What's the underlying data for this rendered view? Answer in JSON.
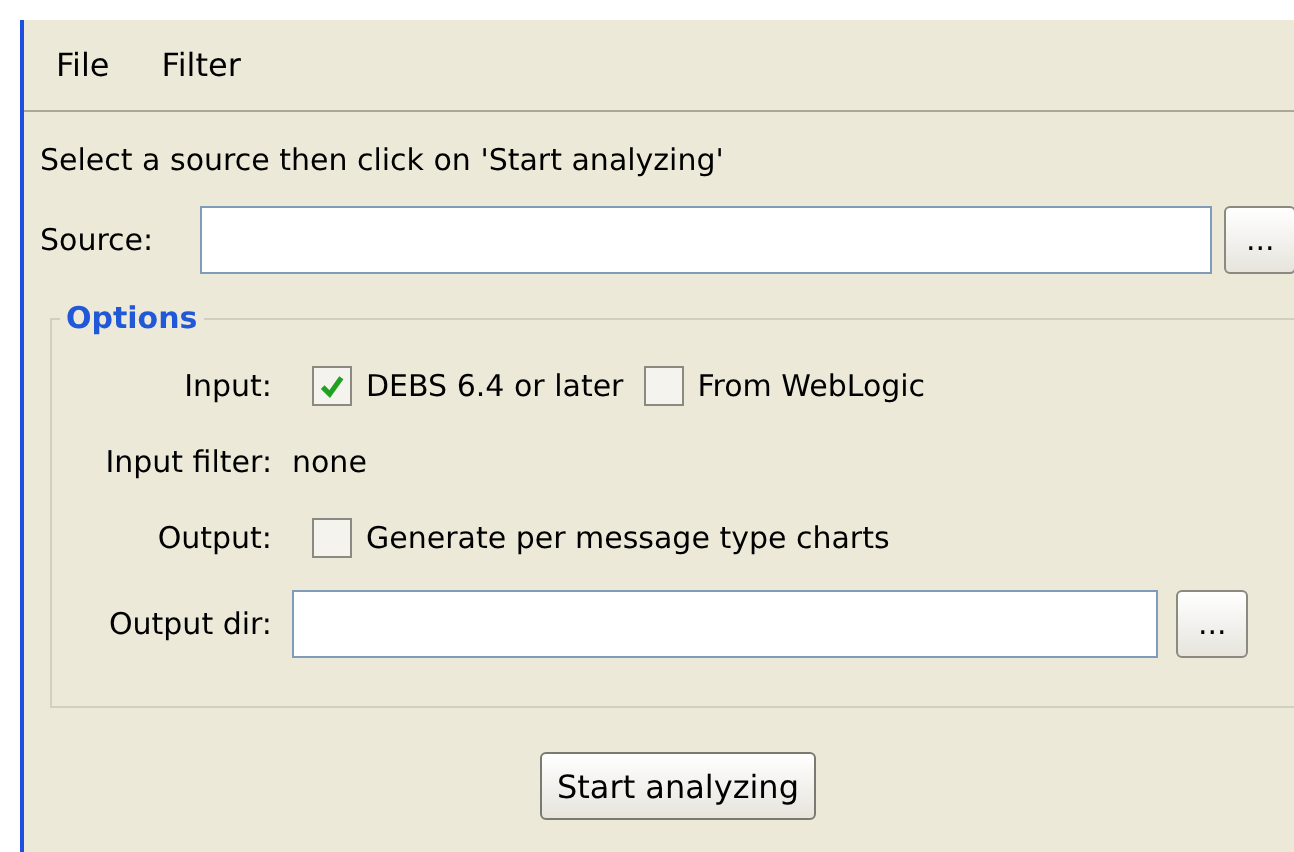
{
  "menu": [
    {
      "label": "File"
    },
    {
      "label": "Filter"
    }
  ],
  "instruction": "Select a source then click on 'Start analyzing'",
  "source": {
    "label": "Source:",
    "browse": "..."
  },
  "options": {
    "title": "Options",
    "rows": [
      {
        "kind": "checks",
        "label": "Input:",
        "checks": [
          {
            "label": "DEBS 6.4 or later",
            "checked": true
          },
          {
            "label": "From WebLogic",
            "checked": false
          }
        ]
      },
      {
        "kind": "text",
        "label": "Input filter:",
        "value": "none"
      },
      {
        "kind": "checks",
        "label": "Output:",
        "checks": [
          {
            "label": "Generate per message type charts",
            "checked": false
          }
        ]
      },
      {
        "kind": "path",
        "label": "Output dir:",
        "browse": "..."
      }
    ]
  },
  "start_button": "Start analyzing"
}
